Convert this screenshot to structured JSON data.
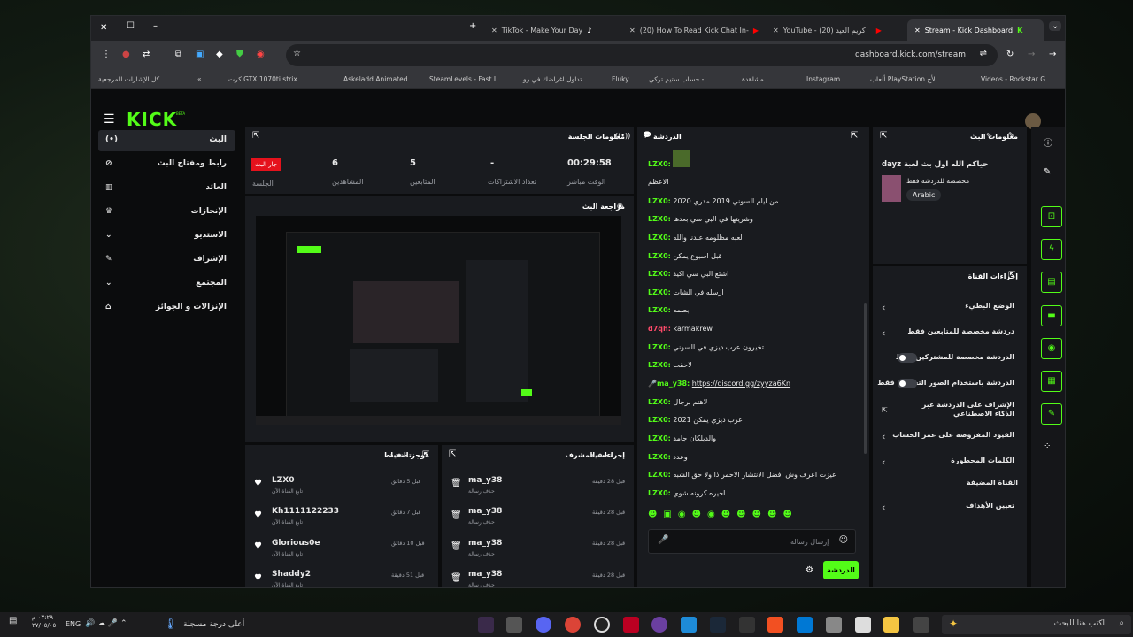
{
  "browser": {
    "tabs": [
      {
        "label": "TikTok - Make Your Day"
      },
      {
        "label": "(20) How To Read Kick Chat In-"
      },
      {
        "label": "YouTube - كريم العيد (20)"
      },
      {
        "label": "Stream - Kick Dashboard"
      }
    ],
    "url": "dashboard.kick.com/stream",
    "bookmarks": [
      "Videos - Rockstar G...",
      "ألعاب PlayStation لأج...",
      "Instagram",
      "مشاهدة",
      "حساب ستيم تركي - ...",
      "Fluky",
      "تداول اغراضك في رو...",
      "SteamLevels - Fast L...",
      "Askeladd Animated...",
      "كرت GTX 1070ti strix...",
      "كل الإشارات المرجعية"
    ]
  },
  "logo": "KICK",
  "logo_badge": "BETA",
  "sidebar": {
    "items": [
      {
        "label": "البث",
        "icon": "radio-icon"
      },
      {
        "label": "رابط ومفتاح البث",
        "icon": "link-icon"
      },
      {
        "label": "العائد",
        "icon": "chart-icon"
      },
      {
        "label": "الإنجازات",
        "icon": "trophy-icon"
      },
      {
        "label": "الاستديو",
        "icon": "studio-icon"
      },
      {
        "label": "الإشراف",
        "icon": "wrench-icon"
      },
      {
        "label": "المجتمع",
        "icon": "community-icon"
      },
      {
        "label": "الإنزالات و الجوائز",
        "icon": "gift-icon"
      }
    ]
  },
  "session": {
    "title": "معلومات الجلسة",
    "live_badge": "جار البث",
    "session_label": "الجلسة",
    "stats": [
      {
        "value": "6",
        "label": "المشاهدين"
      },
      {
        "value": "5",
        "label": "المتابعين"
      },
      {
        "value": "-",
        "label": "تعداد الاشتراكات"
      },
      {
        "value": "00:29:58",
        "label": "الوقت مباشر"
      }
    ]
  },
  "preview": {
    "title": "مراجعة البث"
  },
  "activity": {
    "title": "موجز النشاط",
    "filter": "تصفية",
    "items": [
      {
        "user": "LZX0",
        "desc": "تابع القناة الآن",
        "time": "قبل 5 دقائق"
      },
      {
        "user": "Kh1111122233",
        "desc": "تابع القناة الآن",
        "time": "قبل 7 دقائق"
      },
      {
        "user": "Glorious0e",
        "desc": "تابع القناة الآن",
        "time": "قبل 10 دقائق"
      },
      {
        "user": "Shaddy2",
        "desc": "تابع القناة الآن",
        "time": "قبل 51 دقيقة"
      }
    ]
  },
  "modactions": {
    "title": "إجراءات المشرف",
    "filter": "تصفية",
    "items": [
      {
        "user": "ma_y38",
        "desc": "حذف رسالة",
        "time": "قبل 28 دقيقة"
      },
      {
        "user": "ma_y38",
        "desc": "حذف رسالة",
        "time": "قبل 28 دقيقة"
      },
      {
        "user": "ma_y38",
        "desc": "حذف رسالة",
        "time": "قبل 28 دقيقة"
      },
      {
        "user": "ma_y38",
        "desc": "حذف رسالة",
        "time": "قبل 28 دقيقة"
      }
    ]
  },
  "chat": {
    "title": "الدردشة",
    "messages": [
      {
        "user": "LZX0:",
        "text": ""
      },
      {
        "user": "",
        "text": "الاعظم"
      },
      {
        "user": "LZX0:",
        "text": "من ايام السوني 2019 مدري 2020"
      },
      {
        "user": "LZX0:",
        "text": "وشريتها في البي سي بعدها"
      },
      {
        "user": "LZX0:",
        "text": "لعبه مظلومه عندنا والله"
      },
      {
        "user": "LZX0:",
        "text": "قبل اسبوع يمكن"
      },
      {
        "user": "LZX0:",
        "text": "اشتع البي سي اكيد"
      },
      {
        "user": "LZX0:",
        "text": "ارسله في الشات"
      },
      {
        "user": "LZX0:",
        "text": "بصمه"
      },
      {
        "user": "d7qh:",
        "text": "karmakrew"
      },
      {
        "user": "LZX0:",
        "text": "تخيرون عرب ديزي في السوني"
      },
      {
        "user": "LZX0:",
        "text": "لاحقت"
      },
      {
        "user": "ma_y38:",
        "text": "https://discord.gg/zyyza6Kn"
      },
      {
        "user": "LZX0:",
        "text": "لاهتم برجال"
      },
      {
        "user": "LZX0:",
        "text": "عرب ديزي يمكن 2021"
      },
      {
        "user": "LZX0:",
        "text": "والديلكان جامد"
      },
      {
        "user": "LZX0:",
        "text": "وعدد"
      },
      {
        "user": "LZX0:",
        "text": "عيزت اعرف وش افضل الانتشار الاحمر ذا ولا حق الشبه"
      },
      {
        "user": "LZX0:",
        "text": "اخيره كرونه شوي"
      }
    ],
    "placeholder": "إرسال رسالة",
    "send": "الدردشة"
  },
  "streaminfo": {
    "title": "معلومات البث",
    "stream_title": "حياكم الله اول بث لعبة dayz",
    "category": "مخصصة للدردشة فقط",
    "language": "Arabic"
  },
  "channel": {
    "title": "إجراءات القناة",
    "items": [
      {
        "label": "الوضع البطيء"
      },
      {
        "label": "دردشة مخصصة للمتابعين فقط"
      },
      {
        "label": "الدردشة مخصصة للمشتركين فقط"
      },
      {
        "label": "الدردشة باستخدام الصور التعبيرية فقط"
      },
      {
        "label": "الإشراف على الدردشة عبر الذكاء الاصطناعي"
      },
      {
        "label": "القيود المفروضة على عمر الحساب"
      },
      {
        "label": "الكلمات المحظورة"
      }
    ],
    "section": "القناة المضيفة",
    "target": "تعيين الأهداف"
  },
  "taskbar": {
    "search": "اكتب هنا للبحث",
    "weather": "أعلى درجة مسجلة",
    "lang": "ENG",
    "time": "٠٣:٢٩ م",
    "date": "٢٧/٠٥/٠٥"
  },
  "colors": {
    "accent": "#53fc18",
    "live": "#e5121c",
    "panel": "#191b1f"
  }
}
